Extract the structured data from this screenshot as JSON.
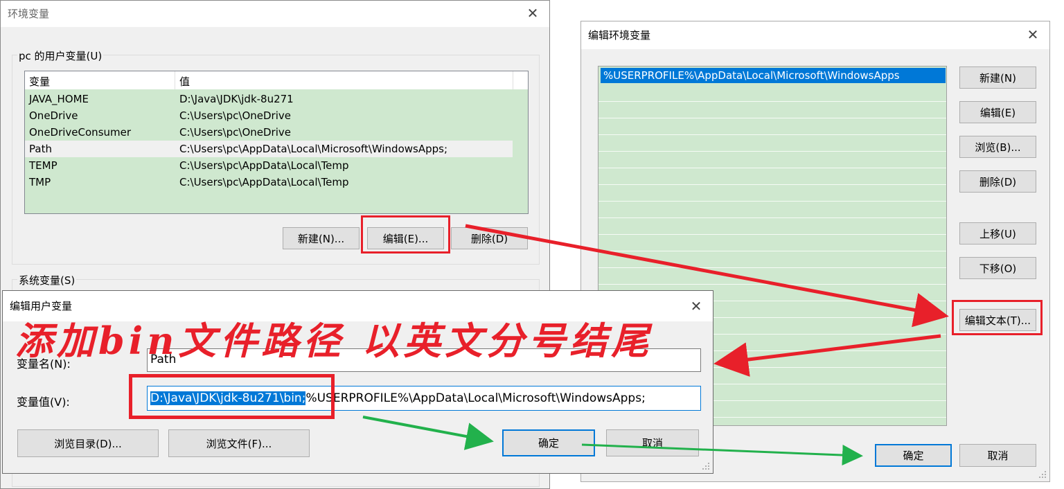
{
  "env_dialog": {
    "title": "环境变量",
    "user_group_label": "pc 的用户变量(U)",
    "columns": [
      "变量",
      "值"
    ],
    "rows": [
      {
        "name": "JAVA_HOME",
        "value": "D:\\Java\\JDK\\jdk-8u271"
      },
      {
        "name": "OneDrive",
        "value": "C:\\Users\\pc\\OneDrive"
      },
      {
        "name": "OneDriveConsumer",
        "value": "C:\\Users\\pc\\OneDrive"
      },
      {
        "name": "Path",
        "value": "C:\\Users\\pc\\AppData\\Local\\Microsoft\\WindowsApps;"
      },
      {
        "name": "TEMP",
        "value": "C:\\Users\\pc\\AppData\\Local\\Temp"
      },
      {
        "name": "TMP",
        "value": "C:\\Users\\pc\\AppData\\Local\\Temp"
      }
    ],
    "selected_row": "Path",
    "new_label": "新建(N)...",
    "edit_label": "编辑(E)...",
    "delete_label": "删除(D)",
    "system_group_label": "系统变量(S)"
  },
  "edit_env_dialog": {
    "title": "编辑环境变量",
    "items": [
      "%USERPROFILE%\\AppData\\Local\\Microsoft\\WindowsApps"
    ],
    "new_label": "新建(N)",
    "edit_label": "编辑(E)",
    "browse_label": "浏览(B)...",
    "delete_label": "删除(D)",
    "move_up_label": "上移(U)",
    "move_down_label": "下移(O)",
    "edit_text_label": "编辑文本(T)...",
    "ok_label": "确定",
    "cancel_label": "取消"
  },
  "edit_user_var_dialog": {
    "title": "编辑用户变量",
    "name_label": "变量名(N):",
    "name_value": "Path",
    "value_label": "变量值(V):",
    "value_selected": "D:\\Java\\JDK\\jdk-8u271\\bin;",
    "value_rest": "%USERPROFILE%\\AppData\\Local\\Microsoft\\WindowsApps;",
    "browse_dir_label": "浏览目录(D)...",
    "browse_file_label": "浏览文件(F)...",
    "ok_label": "确定",
    "cancel_label": "取消"
  },
  "annotation": {
    "text": "添加bin文件路径 以英文分号结尾",
    "color": "#e8202a",
    "arrow_red": "#e8202a",
    "arrow_green": "#22b14c"
  },
  "colors": {
    "list_bg": "#cfe8cf",
    "selection": "#0078d7",
    "dialog_bg": "#f0f0f0"
  }
}
